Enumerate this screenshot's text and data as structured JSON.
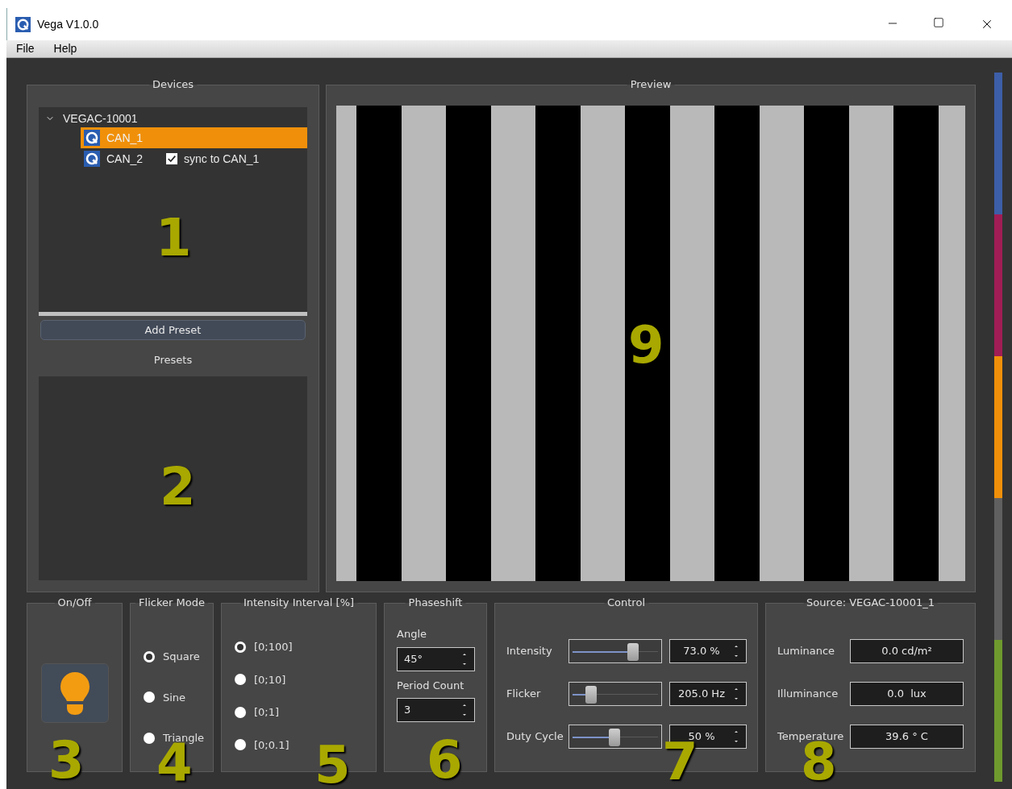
{
  "window": {
    "title": "Vega V1.0.0"
  },
  "menu": [
    {
      "label": "File"
    },
    {
      "label": "Help"
    }
  ],
  "devices": {
    "title": "Devices",
    "marker": "1",
    "tree": [
      {
        "label": "VEGAC-10001",
        "expanded": true,
        "children": [
          {
            "label": "CAN_1",
            "selected": true
          },
          {
            "label": "CAN_2",
            "selected": false,
            "sync": {
              "label": "sync to CAN_1",
              "checked": true
            }
          }
        ]
      }
    ]
  },
  "add_preset_button": "Add Preset",
  "presets": {
    "title": "Presets",
    "marker": "2"
  },
  "preview": {
    "title": "Preview",
    "marker": "9"
  },
  "on_off": {
    "title": "On/Off",
    "marker": "3",
    "on": true
  },
  "flicker_mode": {
    "title": "Flicker Mode",
    "marker": "4",
    "options": [
      {
        "label": "Square",
        "selected": true
      },
      {
        "label": "Sine",
        "selected": false
      },
      {
        "label": "Triangle",
        "selected": false
      }
    ]
  },
  "intensity_interval": {
    "title": "Intensity Interval [%]",
    "marker": "5",
    "options": [
      {
        "label": "[0;100]",
        "selected": true
      },
      {
        "label": "[0;10]",
        "selected": false
      },
      {
        "label": "[0;1]",
        "selected": false
      },
      {
        "label": "[0;0.1]",
        "selected": false
      }
    ]
  },
  "phaseshift": {
    "title": "Phaseshift",
    "marker": "6",
    "fields": [
      {
        "label": "Angle",
        "value": "45°"
      },
      {
        "label": "Period Count",
        "value": "3"
      }
    ]
  },
  "control": {
    "title": "Control",
    "marker": "7",
    "rows": [
      {
        "label": "Intensity",
        "level": 0.72,
        "value": "73.0 %"
      },
      {
        "label": "Flicker",
        "level": 0.22,
        "value": "205.0 Hz"
      },
      {
        "label": "Duty Cycle",
        "level": 0.5,
        "value": "50 %"
      }
    ]
  },
  "source": {
    "title": "Source: VEGAC-10001_1",
    "marker": "8",
    "rows": [
      {
        "label": "Luminance",
        "value": "0.0 cd/m²"
      },
      {
        "label": "Illuminance",
        "value": "0.0  lux"
      },
      {
        "label": "Temperature",
        "value": "39.6 ° C"
      }
    ]
  },
  "color_strip": [
    {
      "color": "#3d5ea8"
    },
    {
      "color": "#a11d55"
    },
    {
      "color": "#f0900a"
    },
    {
      "color": "#606060"
    },
    {
      "color": "#6f9a2e"
    }
  ]
}
